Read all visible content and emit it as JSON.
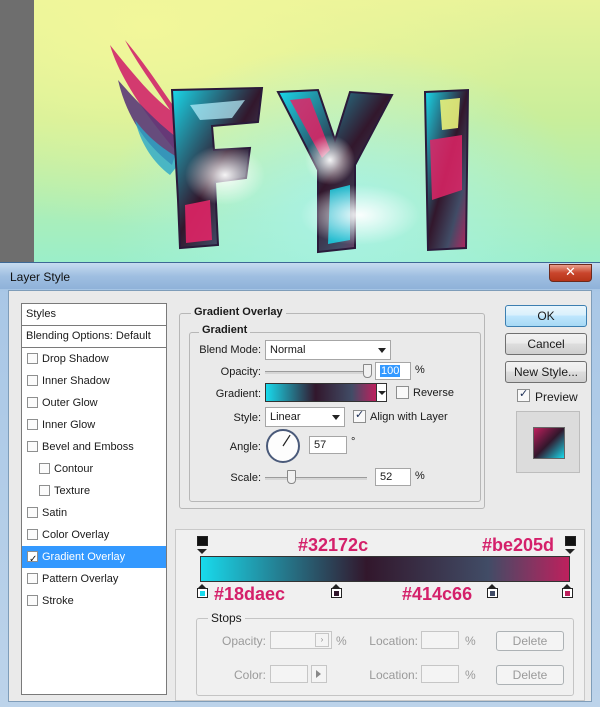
{
  "artwork": {
    "text": "FYI"
  },
  "window": {
    "title": "Layer Style",
    "close_label": "✕"
  },
  "styles_list": {
    "header": "Styles",
    "blending": "Blending Options: Default",
    "items": [
      {
        "label": "Drop Shadow",
        "checked": false
      },
      {
        "label": "Inner Shadow",
        "checked": false
      },
      {
        "label": "Outer Glow",
        "checked": false
      },
      {
        "label": "Inner Glow",
        "checked": false
      },
      {
        "label": "Bevel and Emboss",
        "checked": false
      },
      {
        "label": "Contour",
        "checked": false
      },
      {
        "label": "Texture",
        "checked": false
      },
      {
        "label": "Satin",
        "checked": false
      },
      {
        "label": "Color Overlay",
        "checked": false
      },
      {
        "label": "Gradient Overlay",
        "checked": true
      },
      {
        "label": "Pattern Overlay",
        "checked": false
      },
      {
        "label": "Stroke",
        "checked": false
      }
    ]
  },
  "panel": {
    "title": "Gradient Overlay",
    "group_title": "Gradient",
    "blend_mode_label": "Blend Mode:",
    "blend_mode_value": "Normal",
    "opacity_label": "Opacity:",
    "opacity_value": "100",
    "opacity_unit": "%",
    "gradient_label": "Gradient:",
    "reverse_label": "Reverse",
    "reverse_checked": false,
    "style_label": "Style:",
    "style_value": "Linear",
    "align_label": "Align with Layer",
    "align_checked": true,
    "angle_label": "Angle:",
    "angle_value": "57",
    "angle_unit": "°",
    "scale_label": "Scale:",
    "scale_value": "52",
    "scale_unit": "%",
    "opacity_level": 1.0,
    "scale_level": 0.25
  },
  "buttons": {
    "ok": "OK",
    "cancel": "Cancel",
    "new_style": "New Style...",
    "preview_label": "Preview",
    "preview_checked": true
  },
  "gradient_editor": {
    "colors": [
      "#18daec",
      "#32172c",
      "#414c66",
      "#be205d"
    ],
    "hex_labels": {
      "top_left": "#32172c",
      "top_right": "#be205d",
      "bottom_left": "#18daec",
      "bottom_mid": "#414c66"
    },
    "stops_title": "Stops",
    "opacity_label": "Opacity:",
    "opacity_unit": "%",
    "location_label": "Location:",
    "location_unit": "%",
    "color_label": "Color:",
    "delete_label": "Delete"
  },
  "colors": {
    "selection": "#3399ff",
    "hex_annotation": "#d4206a",
    "dialog_frame": "#a9c7e6"
  }
}
